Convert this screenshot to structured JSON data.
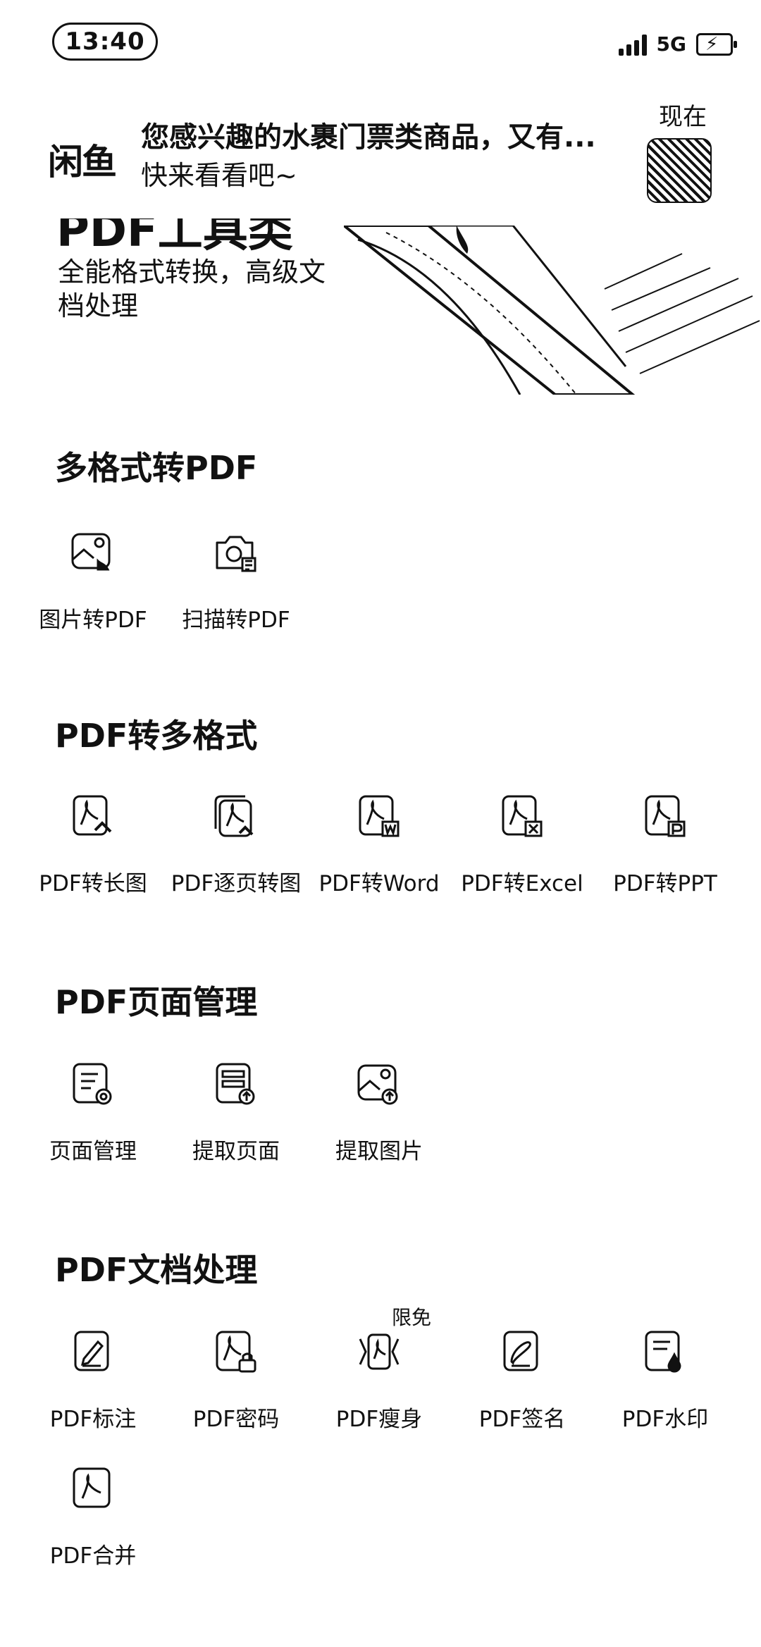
{
  "status_bar": {
    "time": "13:40",
    "network": "5G"
  },
  "notification": {
    "app_logo": "闲鱼",
    "title": "您感兴趣的水裹门票类商品，又有...",
    "body": "快来看看吧~",
    "time": "现在"
  },
  "banner": {
    "title": "PDF工具类",
    "description": "全能格式转换，高级文档处理"
  },
  "sections": [
    {
      "title": "多格式转PDF",
      "tools": [
        {
          "label": "图片转PDF",
          "icon": "image-to-pdf-icon"
        },
        {
          "label": "扫描转PDF",
          "icon": "scan-to-pdf-icon"
        }
      ]
    },
    {
      "title": "PDF转多格式",
      "tools": [
        {
          "label": "PDF转长图",
          "icon": "pdf-to-long-image-icon"
        },
        {
          "label": "PDF逐页转图",
          "icon": "pdf-pages-to-images-icon"
        },
        {
          "label": "PDF转Word",
          "icon": "pdf-to-word-icon"
        },
        {
          "label": "PDF转Excel",
          "icon": "pdf-to-excel-icon"
        },
        {
          "label": "PDF转PPT",
          "icon": "pdf-to-ppt-icon"
        }
      ]
    },
    {
      "title": "PDF页面管理",
      "tools": [
        {
          "label": "页面管理",
          "icon": "page-manage-icon"
        },
        {
          "label": "提取页面",
          "icon": "extract-pages-icon"
        },
        {
          "label": "提取图片",
          "icon": "extract-images-icon"
        }
      ]
    },
    {
      "title": "PDF文档处理",
      "tools": [
        {
          "label": "PDF标注",
          "icon": "pdf-annotate-icon"
        },
        {
          "label": "PDF密码",
          "icon": "pdf-password-icon"
        },
        {
          "label": "PDF瘦身",
          "icon": "pdf-compress-icon",
          "badge": "限免"
        },
        {
          "label": "PDF签名",
          "icon": "pdf-sign-icon"
        },
        {
          "label": "PDF水印",
          "icon": "pdf-watermark-icon"
        },
        {
          "label": "PDF合并",
          "icon": "pdf-merge-icon"
        }
      ]
    }
  ]
}
